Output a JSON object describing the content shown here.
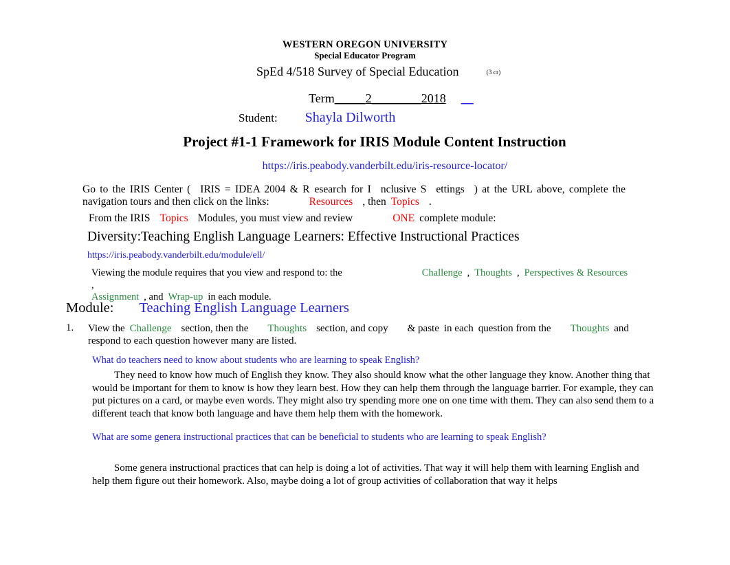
{
  "document": {
    "header": {
      "university": "WESTERN OREGON UNIVERSITY",
      "program": "Special Educator Program",
      "course": "SpEd 4/518 Survey of Special Education",
      "credits": "(3 cr)",
      "term_label": "Term",
      "term_blank1": "_____",
      "term_value": "2",
      "term_blank2": "________",
      "term_year": "2018",
      "term_blank3": "__",
      "student_label": "Student:",
      "student_name": "Shayla Dilworth"
    },
    "title": "Project #1-1 Framework for IRIS Module Content Instruction",
    "resource_locator_url": "https://iris.peabody.vanderbilt.edu/iris-resource-locator/",
    "instructions": {
      "line1_a": "Go to the IRIS Center (",
      "line1_b": "IRIS = IDEA 2004 & R",
      "line1_c": "esearch for I",
      "line1_d": "nclusive S",
      "line1_e": "ettings",
      "line1_f": ") at the URL above, complete the navigation tours and then click on the links:",
      "link_resources": "Resources",
      "then_text": ", then",
      "link_topics": "Topics",
      "period": ".",
      "line2_a": "From the IRIS",
      "line2_topics": "Topics",
      "line2_b": "Modules, you must view and review",
      "line2_one": "ONE",
      "line2_c": "complete module:"
    },
    "module": {
      "name": "Diversity:Teaching English Language Learners: Effective Instructional Practices",
      "url": "https://iris.peabody.vanderbilt.edu/module/ell/",
      "viewing_a": "Viewing the module requires that you view and respond to: the",
      "viewing_challenge": "Challenge",
      "viewing_comma1": ",",
      "viewing_thoughts": "Thoughts",
      "viewing_comma2": ",",
      "viewing_perspectives": "Perspectives & Resources",
      "viewing_comma3": ",",
      "viewing_assignment": "Assignment",
      "viewing_and": ", and",
      "viewing_wrapup": "Wrap-up",
      "viewing_end": "in each module.",
      "heading_label": "Module:",
      "heading_value": "Teaching English Language Learners"
    },
    "task": {
      "number": "1.",
      "part_a": "View the",
      "challenge": "Challenge",
      "part_b": "section, then the",
      "thoughts1": "Thoughts",
      "part_c": "section, and copy",
      "part_d": "& paste",
      "part_e": "in each",
      "part_f": "question from the",
      "thoughts2": "Thoughts",
      "part_g": "and",
      "part_h": "respond to each question however many are listed."
    },
    "qa": [
      {
        "question": "What do teachers need to know about students who are learning to speak English?",
        "answer": "They need to know how much of English they know. They also should know what the other language they know. Another thing that would be important for them to know is how they learn best. How they can help them through the language barrier. For example, they can put pictures on a card, or maybe even words. They might also try spending more one on one time with them. They can also send them to a different teach that know both language and have them help them with the homework."
      },
      {
        "question": "What are some genera instructional practices that can be beneficial to students who are learning to speak English?",
        "answer": "Some genera instructional practices that can help is doing a lot of activities. That way it will help them with learning English and help them figure out their homework. Also, maybe doing a lot of group activities of collaboration that way it helps"
      }
    ],
    "colors": {
      "link_blue": "#2222dd",
      "accent_red": "#ff0000",
      "accent_green": "#2a8a3e",
      "body_black": "#000000"
    }
  }
}
